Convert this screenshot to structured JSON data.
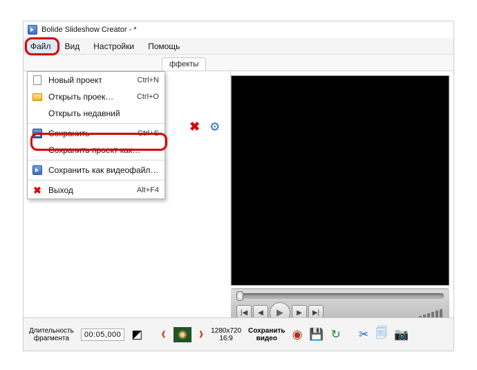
{
  "window": {
    "title": "Bolide Slideshow Creator - *"
  },
  "menubar": {
    "items": [
      "Файл",
      "Вид",
      "Настройки",
      "Помощь"
    ]
  },
  "tabs": {
    "effects": "ффекты"
  },
  "file_menu": {
    "new_project": "Новый проект",
    "new_project_sc": "Ctrl+N",
    "open_project": "Открыть проек…",
    "open_project_sc": "Ctrl+O",
    "open_recent": "Открыть недавний",
    "save": "Сохранить",
    "save_sc": "Ctrl+S",
    "save_project_as": "Сохранить проект как…",
    "save_as_video": "Сохранить как видеофайл…",
    "exit": "Выход",
    "exit_sc": "Alt+F4"
  },
  "status": {
    "duration_label_l1": "Длительность",
    "duration_label_l2": "фрагмента",
    "duration_value": "00:05,000",
    "resolution_l1": "1280x720",
    "resolution_l2": "16:9",
    "save_video_l1": "Сохранить",
    "save_video_l2": "видео"
  }
}
